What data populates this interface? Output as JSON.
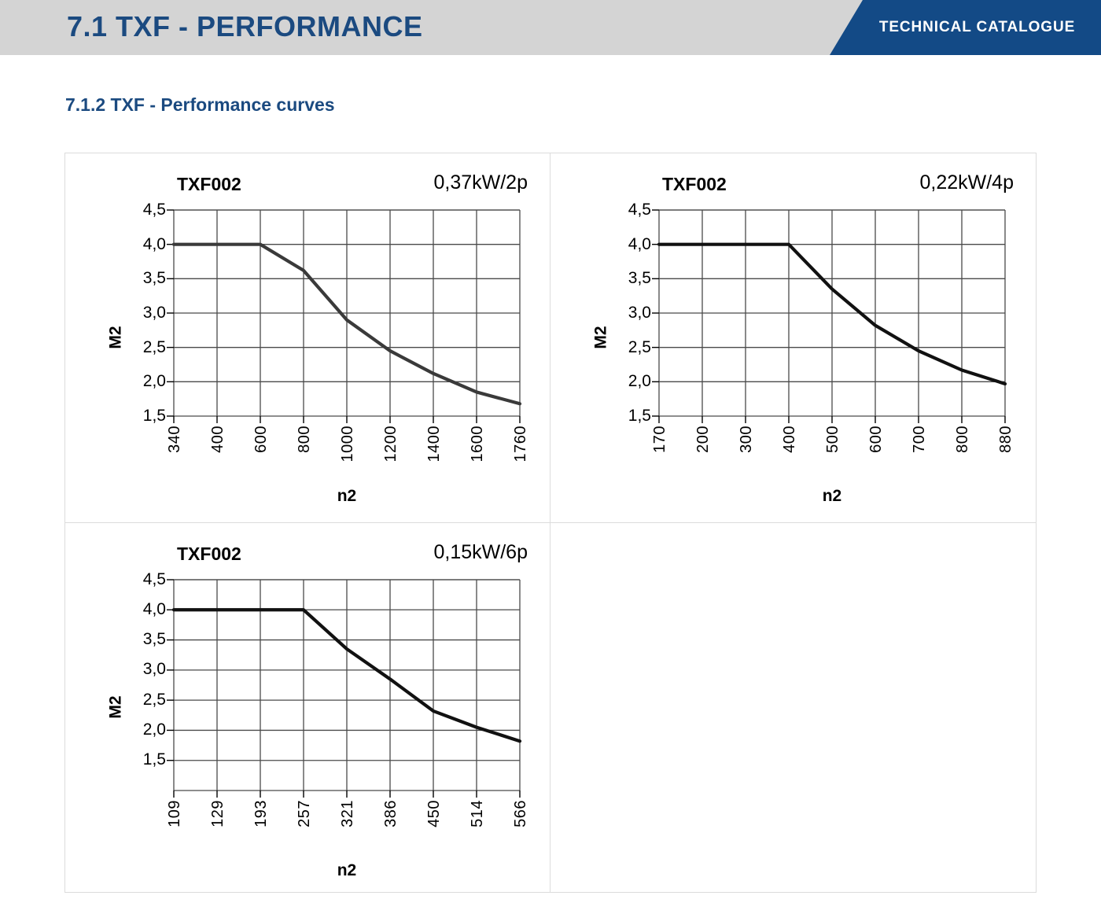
{
  "header": {
    "title": "7.1 TXF - PERFORMANCE",
    "banner_label": "TECHNICAL CATALOGUE",
    "band_color": "#d4d4d4",
    "banner_color": "#134a86",
    "title_color": "#1b4a80"
  },
  "section": {
    "subtitle": "7.1.2 TXF - Performance curves",
    "subtitle_color": "#1b4a80"
  },
  "charts": [
    {
      "model": "TXF002",
      "power": "0,37kW/2p",
      "ylabel": "M2",
      "xlabel": "n2",
      "yticks": [
        "4,5",
        "4,0",
        "3,5",
        "3,0",
        "2,5",
        "2,0",
        "1,5"
      ],
      "xticks": [
        "340",
        "400",
        "600",
        "800",
        "1000",
        "1200",
        "1400",
        "1600",
        "1760"
      ]
    },
    {
      "model": "TXF002",
      "power": "0,22kW/4p",
      "ylabel": "M2",
      "xlabel": "n2",
      "yticks": [
        "4,5",
        "4,0",
        "3,5",
        "3,0",
        "2,5",
        "2,0",
        "1,5"
      ],
      "xticks": [
        "170",
        "200",
        "300",
        "400",
        "500",
        "600",
        "700",
        "800",
        "880"
      ]
    },
    {
      "model": "TXF002",
      "power": "0,15kW/6p",
      "ylabel": "M2",
      "xlabel": "n2",
      "yticks": [
        "4,5",
        "4,0",
        "3,5",
        "3,0",
        "2,5",
        "2,0",
        "1,5"
      ],
      "xticks": [
        "109",
        "129",
        "193",
        "257",
        "321",
        "386",
        "450",
        "514",
        "566"
      ]
    }
  ],
  "chart_data": [
    {
      "type": "line",
      "title": "TXF002",
      "annotation": "0,37kW/2p",
      "xlabel": "n2",
      "ylabel": "M2",
      "categories": [
        340,
        400,
        600,
        800,
        1000,
        1200,
        1400,
        1600,
        1760
      ],
      "tick_labels": [
        "340",
        "400",
        "600",
        "800",
        "1000",
        "1200",
        "1400",
        "1600",
        "1760"
      ],
      "values": [
        4.0,
        4.0,
        4.0,
        3.62,
        2.9,
        2.45,
        2.12,
        1.85,
        1.68
      ],
      "ylim": [
        1.5,
        4.5
      ],
      "yticks": [
        1.5,
        2.0,
        2.5,
        3.0,
        3.5,
        4.0,
        4.5
      ],
      "ytick_labels": [
        "1,5",
        "2,0",
        "2,5",
        "3,0",
        "3,5",
        "4,0",
        "4,5"
      ],
      "grid": true,
      "legend": "none",
      "line_color": "#3a3a3a"
    },
    {
      "type": "line",
      "title": "TXF002",
      "annotation": "0,22kW/4p",
      "xlabel": "n2",
      "ylabel": "M2",
      "categories": [
        170,
        200,
        300,
        400,
        500,
        600,
        700,
        800,
        880
      ],
      "tick_labels": [
        "170",
        "200",
        "300",
        "400",
        "500",
        "600",
        "700",
        "800",
        "880"
      ],
      "values": [
        4.0,
        4.0,
        4.0,
        4.0,
        3.35,
        2.82,
        2.45,
        2.17,
        1.97
      ],
      "ylim": [
        1.5,
        4.5
      ],
      "yticks": [
        1.5,
        2.0,
        2.5,
        3.0,
        3.5,
        4.0,
        4.5
      ],
      "ytick_labels": [
        "1,5",
        "2,0",
        "2,5",
        "3,0",
        "3,5",
        "4,0",
        "4,5"
      ],
      "grid": true,
      "legend": "none",
      "line_color": "#111111"
    },
    {
      "type": "line",
      "title": "TXF002",
      "annotation": "0,15kW/6p",
      "xlabel": "n2",
      "ylabel": "M2",
      "categories": [
        109,
        129,
        193,
        257,
        321,
        386,
        450,
        514,
        566
      ],
      "tick_labels": [
        "109",
        "129",
        "193",
        "257",
        "321",
        "386",
        "450",
        "514",
        "566"
      ],
      "values": [
        4.0,
        4.0,
        4.0,
        4.0,
        3.35,
        2.85,
        2.32,
        2.05,
        1.82
      ],
      "ylim": [
        1.0,
        4.5
      ],
      "yticks": [
        1.5,
        2.0,
        2.5,
        3.0,
        3.5,
        4.0,
        4.5
      ],
      "ytick_labels": [
        "1,5",
        "2,0",
        "2,5",
        "3,0",
        "3,5",
        "4,0",
        "4,5"
      ],
      "grid": true,
      "legend": "none",
      "line_color": "#111111"
    }
  ]
}
